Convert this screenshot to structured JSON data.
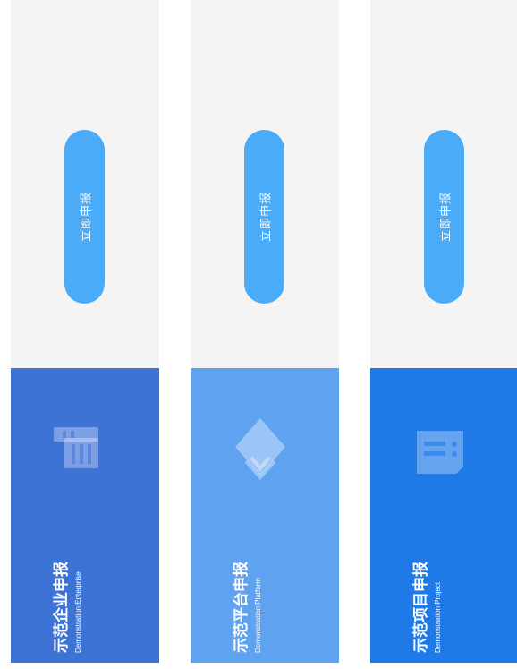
{
  "cards": [
    {
      "title": "示范企业申报",
      "subtitle": "Demonstration Enterprise",
      "button_label": "立即申报",
      "icon": "building-icon",
      "color": "#3e73d6"
    },
    {
      "title": "示范平台申报",
      "subtitle": "Demonstration Platform",
      "button_label": "立即申报",
      "icon": "layers-icon",
      "color": "#5ea2f0"
    },
    {
      "title": "示范项目申报",
      "subtitle": "Demonstration Project",
      "button_label": "立即申报",
      "icon": "document-icon",
      "color": "#1f7ae8"
    }
  ],
  "colors": {
    "panel_background": "#f4f4f4",
    "button_background": "#4aabf8",
    "text": "#ffffff"
  }
}
